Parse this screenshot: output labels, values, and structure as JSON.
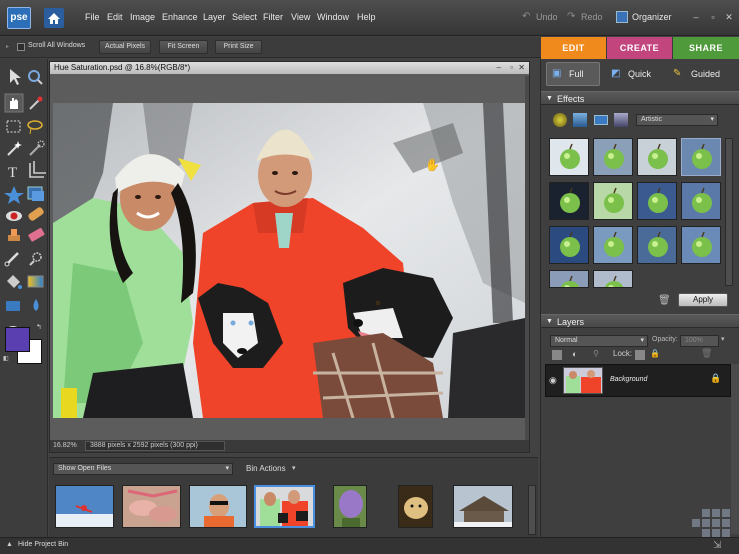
{
  "app": {
    "logo_text": "pse",
    "menu": [
      "File",
      "Edit",
      "Image",
      "Enhance",
      "Layer",
      "Select",
      "Filter",
      "View",
      "Window",
      "Help"
    ],
    "undo_label": "Undo",
    "redo_label": "Redo",
    "organizer_label": "Organizer"
  },
  "options_bar": {
    "scroll_all_label": "Scroll All Windows",
    "actual_pixels_label": "Actual Pixels",
    "fit_screen_label": "Fit Screen",
    "print_size_label": "Print Size"
  },
  "mode_tabs": [
    {
      "label": "EDIT",
      "color": "#f08a1c"
    },
    {
      "label": "CREATE",
      "color": "#c2457e"
    },
    {
      "label": "SHARE",
      "color": "#4f9a3a"
    }
  ],
  "edit_subtabs": [
    "Full",
    "Quick",
    "Guided"
  ],
  "document": {
    "title": "Hue Saturation.psd @ 16.8%(RGB/8*)",
    "zoom": "16.82%",
    "info": "3888 pixels x 2592 pixels (300 ppi)"
  },
  "colors": {
    "foreground": "#5a3fb0",
    "background": "#ffffff"
  },
  "project_bin": {
    "show_label": "Show Open Files",
    "bin_actions_label": "Bin Actions"
  },
  "bottom": {
    "hide_bin_label": "Hide Project Bin"
  },
  "effects": {
    "header": "Effects",
    "category": "Artistic",
    "apply_label": "Apply"
  },
  "layers": {
    "header": "Layers",
    "blend_mode": "Normal",
    "opacity_label": "Opacity:",
    "opacity_value": "100%",
    "lock_label": "Lock:",
    "layer_name": "Background"
  }
}
